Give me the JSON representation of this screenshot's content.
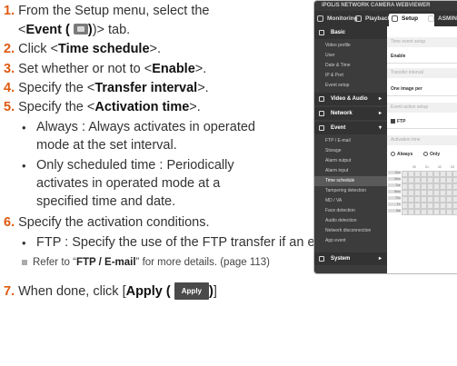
{
  "steps": [
    {
      "num": "1.",
      "pre": " From the Setup menu, select the"
    },
    {
      "num": "2.",
      "pre": " Click <",
      "bold": "Time schedule",
      "post": ">."
    },
    {
      "num": "3.",
      "pre": " Set whether or not to <",
      "bold": "Enable",
      "post": ">."
    },
    {
      "num": "4.",
      "pre": " Specify the <",
      "bold": "Transfer interval",
      "post": ">."
    },
    {
      "num": "5.",
      "pre": " Specify the <",
      "bold": "Activation time",
      "post": ">."
    },
    {
      "num": "6.",
      "pre": " Specify the activation conditions."
    },
    {
      "num": "7.",
      "pre": " When done, click [",
      "bold": "Apply (",
      "post": ")]."
    }
  ],
  "step1_line2": {
    "pre": "<",
    "bold": "Event (",
    "post": ")> tab."
  },
  "bullets": {
    "always_1": "Always : Always activates in operated",
    "always_2": "mode at the set interval.",
    "sched_1": "Only scheduled time : Periodically",
    "sched_2": "activates in operated mode at a",
    "sched_3": "specified time and date.",
    "ftp": "FTP : Specify the use of the FTP transfer if an event occurs."
  },
  "note": {
    "pre": "Refer to “",
    "bold": "FTP / E-mail",
    "post": "” for more details. (page 113)"
  },
  "apply_button": "Apply",
  "screenshot": {
    "window_title": "iPOLiS NETWORK CAMERA WEBVIEWER",
    "tabs": [
      "Monitoring",
      "Playback",
      "Setup",
      "ASMIN"
    ],
    "sidebar": {
      "basic": "Basic",
      "basic_items": [
        "Video profile",
        "User",
        "Date & Time",
        "IP & Port",
        "Event setup"
      ],
      "video_audio": "Video & Audio",
      "network": "Network",
      "event": "Event",
      "event_items": [
        "FTP / E-mail",
        "Storage",
        "Alarm output",
        "Alarm input",
        "Time schedule",
        "Tampering detection",
        "MD / VA",
        "Face detection",
        "Audio detection",
        "Network disconnection",
        "App event"
      ],
      "system": "System"
    },
    "main": {
      "time_event_setup": "Time event setup",
      "enable": "Enable",
      "transfer_interval": "Transfer interval",
      "transfer_value": "One image per",
      "event_action_setup": "Event action setup",
      "ftp": "FTP",
      "activation_time": "Activation time",
      "always": "Always",
      "only": "Only",
      "grid_days": [
        "Sun",
        "Mon",
        "Tue",
        "Wed",
        "Thu",
        "Fri",
        "Sat"
      ],
      "grid_hours": [
        "00",
        "01",
        "02",
        "03"
      ]
    }
  }
}
